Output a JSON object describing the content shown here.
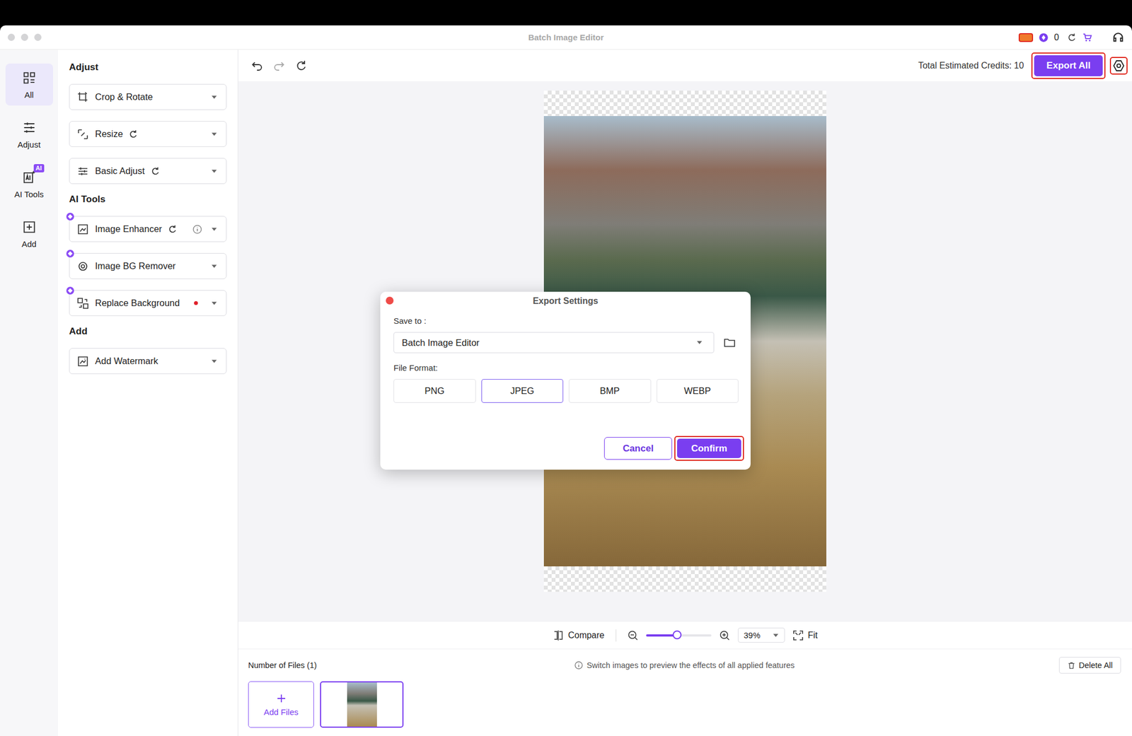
{
  "window": {
    "title": "Batch Image Editor"
  },
  "titlebar": {
    "credits": "0"
  },
  "nav": [
    {
      "label": "All",
      "selected": true
    },
    {
      "label": "Adjust",
      "selected": false
    },
    {
      "label": "AI Tools",
      "selected": false,
      "badge": "AI"
    },
    {
      "label": "Add",
      "selected": false
    }
  ],
  "panel": {
    "sections": [
      {
        "title": "Adjust",
        "items": [
          {
            "label": "Crop & Rotate",
            "ai": false,
            "reset": false,
            "info": false,
            "dot": false
          },
          {
            "label": "Resize",
            "ai": false,
            "reset": true,
            "info": false,
            "dot": false
          },
          {
            "label": "Basic Adjust",
            "ai": false,
            "reset": true,
            "info": false,
            "dot": false
          }
        ]
      },
      {
        "title": "AI Tools",
        "items": [
          {
            "label": "Image Enhancer",
            "ai": true,
            "reset": true,
            "info": true,
            "dot": false
          },
          {
            "label": "Image BG Remover",
            "ai": true,
            "reset": false,
            "info": false,
            "dot": false
          },
          {
            "label": "Replace Background",
            "ai": true,
            "reset": false,
            "info": false,
            "dot": true
          }
        ]
      },
      {
        "title": "Add",
        "items": [
          {
            "label": "Add Watermark",
            "ai": false,
            "reset": false,
            "info": false,
            "dot": false
          }
        ]
      }
    ]
  },
  "toolbar": {
    "credits_label": "Total Estimated Credits:",
    "credits": "10",
    "export": {
      "label": "Export All",
      "highlighted": true
    },
    "settings": {
      "highlighted": true
    }
  },
  "zoom": {
    "compare": "Compare",
    "level": 0.47,
    "value": "39%",
    "fit": "Fit"
  },
  "files": {
    "count_label": "Number of Files (1)",
    "hint": "Switch images to preview the effects of all applied features",
    "delete": "Delete All",
    "add": "Add Files",
    "thumbnails": [
      {
        "selected": true
      }
    ]
  },
  "dialog": {
    "title": "Export Settings",
    "save_to_label": "Save to :",
    "save_to": "Batch Image Editor",
    "format_label": "File Format:",
    "formats": [
      {
        "label": "PNG",
        "selected": false
      },
      {
        "label": "JPEG",
        "selected": true
      },
      {
        "label": "BMP",
        "selected": false
      },
      {
        "label": "WEBP",
        "selected": false
      }
    ],
    "cancel": "Cancel",
    "confirm": {
      "label": "Confirm",
      "highlighted": true
    }
  }
}
